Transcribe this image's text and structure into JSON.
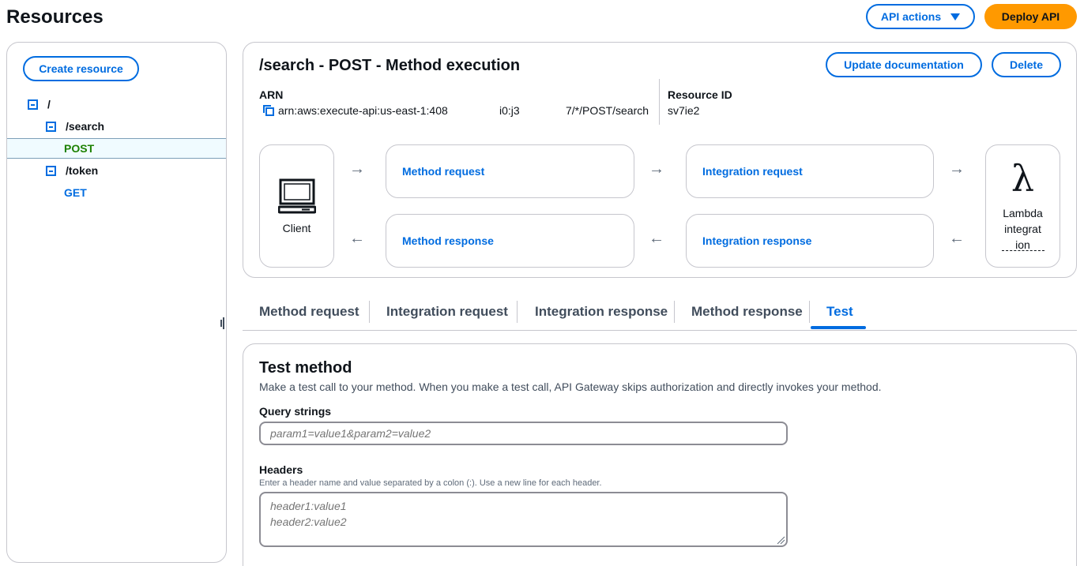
{
  "page": {
    "title": "Resources"
  },
  "header": {
    "api_actions_label": "API actions",
    "deploy_label": "Deploy API"
  },
  "sidebar": {
    "create_label": "Create resource",
    "tree": [
      {
        "label": "/"
      },
      {
        "label": "/search"
      },
      {
        "label": "POST"
      },
      {
        "label": "/token"
      },
      {
        "label": "GET"
      }
    ]
  },
  "method": {
    "title": "/search - POST - Method execution",
    "update_doc_label": "Update documentation",
    "delete_label": "Delete",
    "arn_label": "ARN",
    "arn_value_part1": "arn:aws:execute-api:us-east-1:408",
    "arn_value_part2": "i0:j3",
    "arn_value_part3": "7/*/POST/search",
    "resource_id_label": "Resource ID",
    "resource_id_value": "sv7ie2"
  },
  "flow": {
    "client_label": "Client",
    "method_request": "Method request",
    "integration_request": "Integration request",
    "method_response": "Method response",
    "integration_response": "Integration response",
    "lambda_line1": "Lambda",
    "lambda_line2": "integrat",
    "lambda_line3": "ion",
    "arrow_right": "→",
    "arrow_left": "←",
    "lambda_symbol": "λ"
  },
  "tabs": [
    {
      "label": "Method request"
    },
    {
      "label": "Integration request"
    },
    {
      "label": "Integration response"
    },
    {
      "label": "Method response"
    },
    {
      "label": "Test",
      "active": true
    }
  ],
  "test": {
    "title": "Test method",
    "description": "Make a test call to your method. When you make a test call, API Gateway skips authorization and directly invokes your method.",
    "query_label": "Query strings",
    "query_placeholder": "param1=value1&param2=value2",
    "headers_label": "Headers",
    "headers_hint": "Enter a header name and value separated by a colon (:). Use a new line for each header.",
    "headers_placeholder": "header1:value1\nheader2:value2"
  },
  "colors": {
    "link": "#006ce0",
    "primary": "#ff9900",
    "post": "#1d8102",
    "border": "#c6c6cd"
  }
}
